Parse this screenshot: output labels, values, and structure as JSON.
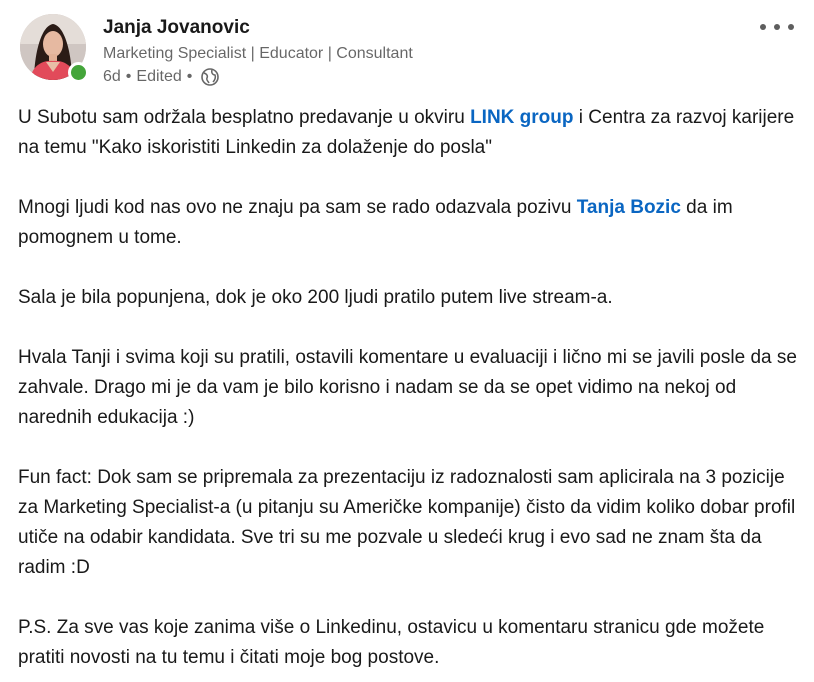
{
  "author": {
    "name": "Janja Jovanovic",
    "headline": "Marketing Specialist | Educator | Consultant",
    "age": "6d",
    "sep": "•",
    "edited": "Edited",
    "visibility_icon": "globe-icon",
    "online": true
  },
  "menu_icon": "more-options-icon",
  "colors": {
    "mention": "#0a66c2",
    "presence": "#44a53a",
    "secondary_text": "#666666"
  },
  "post": {
    "p1": {
      "before": "U Subotu sam održala besplatno predavanje u okviru ",
      "mention": "LINK group",
      "after": " i Centra za razvoj karijere na temu \"Kako iskoristiti Linkedin za dolaženje do posla\""
    },
    "p2": {
      "before": "Mnogi ljudi kod nas ovo ne znaju pa sam se rado odazvala pozivu ",
      "mention": "Tanja Bozic",
      "after": " da im pomognem u tome."
    },
    "p3": "Sala je bila popunjena, dok je oko 200 ljudi pratilo putem live stream-a.",
    "p4": "Hvala Tanji i svima koji su pratili, ostavili komentare u evaluaciji i lično mi se javili posle da se zahvale. Drago mi je da vam je bilo korisno i nadam se da se opet vidimo na nekoj od narednih edukacija :)",
    "p5": "Fun fact: Dok sam se pripremala za prezentaciju iz radoznalosti sam aplicirala na 3 pozicije za Marketing Specialist-a (u pitanju su Američke kompanije) čisto da vidim koliko dobar profil utiče na odabir kandidata. Sve tri su me pozvale u sledeći krug i evo sad ne znam šta da radim :D",
    "p6": "P.S. Za sve vas koje zanima više o Linkedinu, ostavicu u komentaru stranicu gde možete pratiti novosti na tu temu i čitati moje bog postove."
  }
}
